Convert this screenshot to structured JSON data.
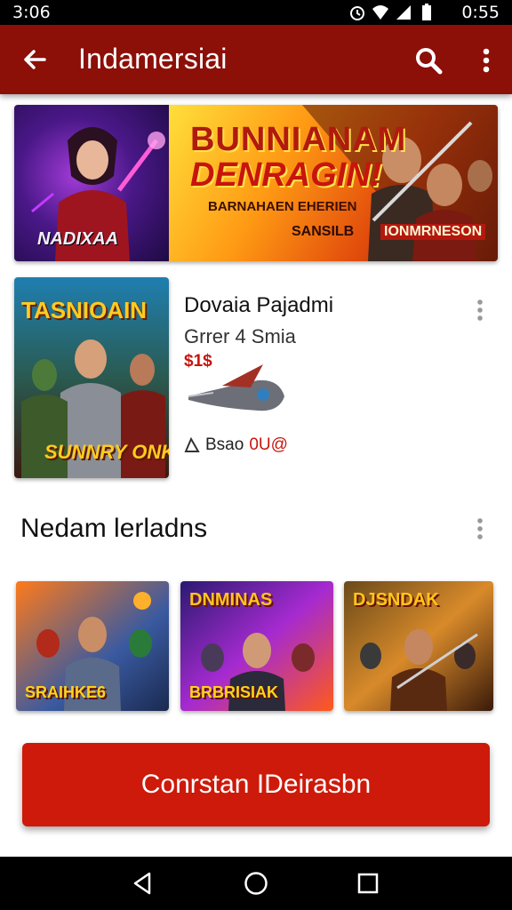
{
  "status_bar": {
    "time_left": "3:06",
    "time_right": "0:55"
  },
  "app_bar": {
    "title": "Indamersiai"
  },
  "banner": {
    "heading_line1": "BUNNIANAM",
    "heading_line2": "DENRAGIN!",
    "subtitle": "BARNAHAEN EHERIEN",
    "left_label": "NADIXAA",
    "tag1": "SANSILB",
    "tag2": "IONMRNESON"
  },
  "feature": {
    "art_title": "TASNIOAIN",
    "art_subtitle": "SUNNRY ONKISIB",
    "title": "Dovaia Pajadmi",
    "subtitle": "Grrer 4 Smia",
    "price": "$1$",
    "meta_text": "Bsao",
    "meta_accent": "0U@"
  },
  "section": {
    "title": "Nedam lerladns",
    "thumbs": [
      {
        "label": "SRAIHKE6"
      },
      {
        "label": "BRBRISIAK",
        "top": "DNMINAS"
      },
      {
        "label": "",
        "top": "DJSNDAK"
      }
    ]
  },
  "cta": {
    "label": "Conrstan IDeirasbn"
  },
  "colors": {
    "app_bar": "#8c0f08",
    "accent": "#cd1a0a",
    "price": "#c8140c"
  },
  "icons": [
    "back-arrow-icon",
    "search-icon",
    "more-vert-icon",
    "triangle-back-icon",
    "circle-home-icon",
    "square-recents-icon"
  ]
}
